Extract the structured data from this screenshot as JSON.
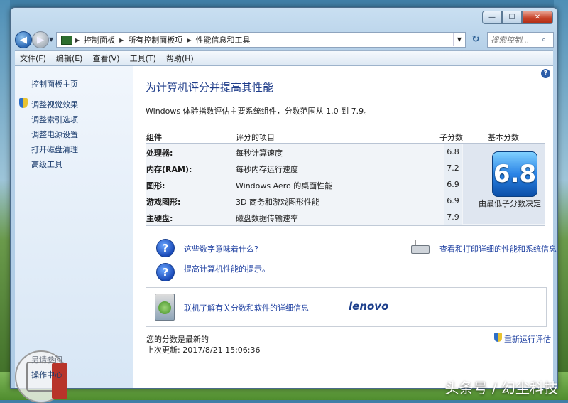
{
  "window": {
    "minimize_label": "—",
    "maximize_label": "☐",
    "close_label": "✕"
  },
  "address": {
    "breadcrumbs": [
      "控制面板",
      "所有控制面板项",
      "性能信息和工具"
    ],
    "search_placeholder": "搜索控制...",
    "search_icon": "search-icon"
  },
  "menubar": {
    "items": [
      "文件(F)",
      "编辑(E)",
      "查看(V)",
      "工具(T)",
      "帮助(H)"
    ]
  },
  "sidebar": {
    "home": "控制面板主页",
    "links": [
      "调整视觉效果",
      "调整索引选项",
      "调整电源设置",
      "打开磁盘清理",
      "高级工具"
    ],
    "see_also": "另请参阅",
    "action_center": "操作中心"
  },
  "main": {
    "title": "为计算机评分并提高其性能",
    "description": "Windows 体验指数评估主要系统组件，分数范围从 1.0 到 7.9。",
    "table": {
      "headers": {
        "component": "组件",
        "rated": "评分的项目",
        "subscore": "子分数",
        "base": "基本分数"
      },
      "rows": [
        {
          "component": "处理器:",
          "item": "每秒计算速度",
          "score": "6.8"
        },
        {
          "component": "内存(RAM):",
          "item": "每秒内存运行速度",
          "score": "7.2"
        },
        {
          "component": "图形:",
          "item": "Windows Aero 的桌面性能",
          "score": "6.9"
        },
        {
          "component": "游戏图形:",
          "item": "3D 商务和游戏图形性能",
          "score": "6.9"
        },
        {
          "component": "主硬盘:",
          "item": "磁盘数据传输速率",
          "score": "7.9"
        }
      ],
      "base_score": "6.8",
      "base_note": "由最低子分数决定"
    },
    "links": {
      "meaning": "这些数字意味着什么?",
      "tips": "提高计算机性能的提示。",
      "print": "查看和打印详细的性能和系统信息",
      "online": "联机了解有关分数和软件的详细信息"
    },
    "brand": "lenovo",
    "status": {
      "current": "您的分数是最新的",
      "last_update": "上次更新: 2017/8/21 15:06:36",
      "rerun": "重新运行评估"
    }
  },
  "watermark": "头条号 / 幻尘科技"
}
